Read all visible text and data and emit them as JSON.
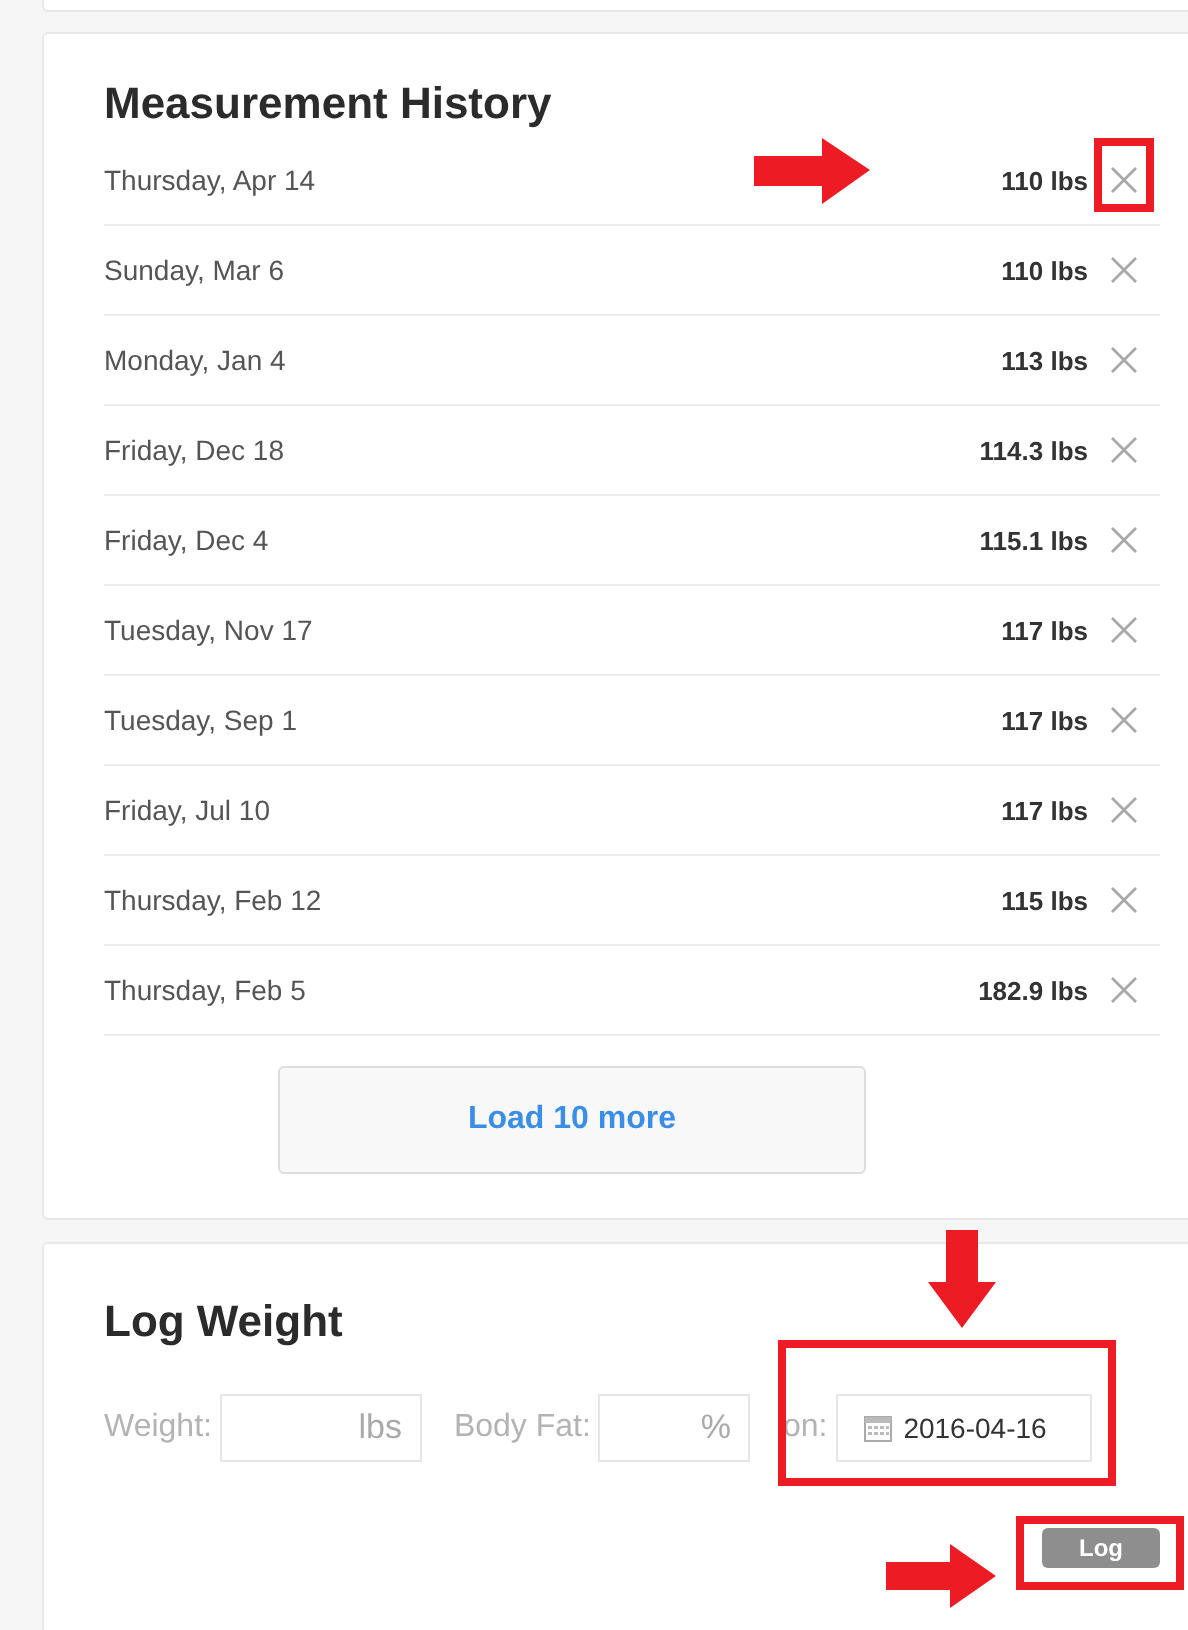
{
  "history": {
    "title": "Measurement History",
    "rows": [
      {
        "date": "Thursday, Apr 14",
        "weight": "110 lbs",
        "highlighted": true
      },
      {
        "date": "Sunday, Mar 6",
        "weight": "110 lbs",
        "highlighted": false
      },
      {
        "date": "Monday, Jan 4",
        "weight": "113 lbs",
        "highlighted": false
      },
      {
        "date": "Friday, Dec 18",
        "weight": "114.3 lbs",
        "highlighted": false
      },
      {
        "date": "Friday, Dec 4",
        "weight": "115.1 lbs",
        "highlighted": false
      },
      {
        "date": "Tuesday, Nov 17",
        "weight": "117 lbs",
        "highlighted": false
      },
      {
        "date": "Tuesday, Sep 1",
        "weight": "117 lbs",
        "highlighted": false
      },
      {
        "date": "Friday, Jul 10",
        "weight": "117 lbs",
        "highlighted": false
      },
      {
        "date": "Thursday, Feb 12",
        "weight": "115 lbs",
        "highlighted": false
      },
      {
        "date": "Thursday, Feb 5",
        "weight": "182.9 lbs",
        "highlighted": false
      }
    ],
    "load_more": "Load 10 more"
  },
  "log": {
    "title": "Log Weight",
    "fields": [
      {
        "label": "Weight:",
        "unit": "lbs"
      },
      {
        "label": "Body Fat:",
        "unit": "%"
      }
    ],
    "date": {
      "label": "on:",
      "value": "2016-04-16",
      "highlighted": true
    },
    "button": {
      "label": "Log",
      "highlighted": true
    }
  }
}
